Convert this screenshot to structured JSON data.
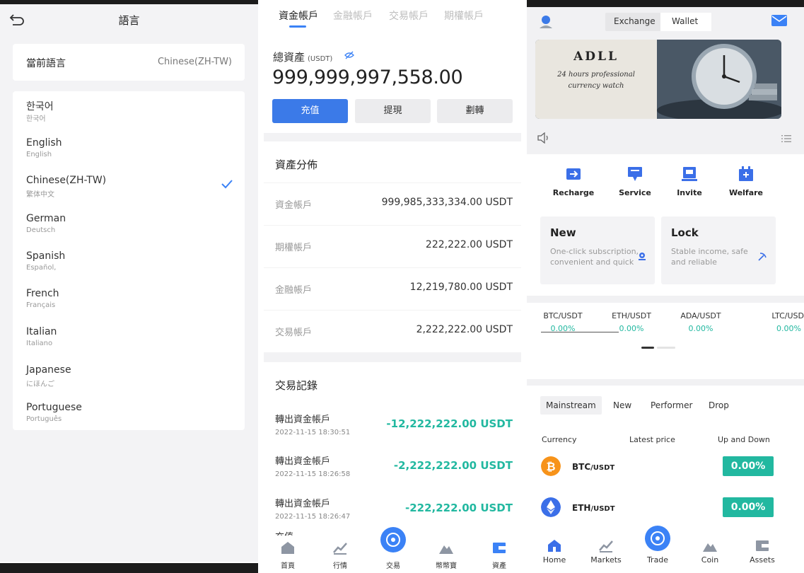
{
  "language_screen": {
    "title": "語言",
    "current_label": "當前語言",
    "current_value": "Chinese(ZH-TW)",
    "languages": [
      {
        "name": "한국어",
        "native": "한국어",
        "selected": false
      },
      {
        "name": "English",
        "native": "English",
        "selected": false
      },
      {
        "name": "Chinese(ZH-TW)",
        "native": "繁体中文",
        "selected": true
      },
      {
        "name": "German",
        "native": "Deutsch",
        "selected": false
      },
      {
        "name": "Spanish",
        "native": "Español,",
        "selected": false
      },
      {
        "name": "French",
        "native": "Français",
        "selected": false
      },
      {
        "name": "Italian",
        "native": "Italiano",
        "selected": false
      },
      {
        "name": "Japanese",
        "native": "にほんご",
        "selected": false
      },
      {
        "name": "Portuguese",
        "native": "Português",
        "selected": false
      }
    ],
    "accent": "#3b82f6"
  },
  "funds_screen": {
    "tabs": [
      "資金帳戶",
      "金融帳戶",
      "交易帳戶",
      "期權帳戶"
    ],
    "active_tab": 0,
    "total_label": "總資產",
    "total_unit": "(USDT)",
    "total_value": "999,999,997,558.00",
    "buttons": {
      "deposit": "充值",
      "withdraw": "提現",
      "transfer": "劃轉"
    },
    "distribution_title": "資產分佈",
    "distribution": [
      {
        "name": "資金帳戶",
        "value": "999,985,333,334.00 USDT"
      },
      {
        "name": "期權帳戶",
        "value": "222,222.00 USDT"
      },
      {
        "name": "金融帳戶",
        "value": "12,219,780.00 USDT"
      },
      {
        "name": "交易帳戶",
        "value": "2,222,222.00 USDT"
      }
    ],
    "records_title": "交易記錄",
    "records": [
      {
        "type": "轉出資金帳戶",
        "time": "2022-11-15 18:30:51",
        "amount": "-12,222,222.00 USDT"
      },
      {
        "type": "轉出資金帳戶",
        "time": "2022-11-15 18:26:58",
        "amount": "-2,222,222.00 USDT"
      },
      {
        "type": "轉出資金帳戶",
        "time": "2022-11-15 18:26:47",
        "amount": "-222,222.00 USDT"
      }
    ],
    "records_partial": "充值",
    "nav": [
      "首頁",
      "行情",
      "交易",
      "幣幣寶",
      "資產"
    ],
    "positive_color": "#22b8a0"
  },
  "exchange_screen": {
    "segment": {
      "exchange": "Exchange",
      "wallet": "Wallet",
      "active": "wallet"
    },
    "banner": {
      "title": "ADLL",
      "subtitle_1": "24 hours professional",
      "subtitle_2": "currency watch"
    },
    "quick_actions": [
      "Recharge",
      "Service",
      "Invite",
      "Welfare"
    ],
    "cards": [
      {
        "title": "New",
        "desc_1": "One-click subscription,",
        "desc_2": "convenient and quick"
      },
      {
        "title": "Lock",
        "desc_1": "Stable income, safe",
        "desc_2": "and reliable"
      }
    ],
    "tickers": [
      {
        "pair": "BTC/USDT",
        "change": "0.00%"
      },
      {
        "pair": "ETH/USDT",
        "change": "0.00%"
      },
      {
        "pair": "ADA/USDT",
        "change": "0.00%"
      },
      {
        "pair": "LTC/USD",
        "change": "0.00%"
      }
    ],
    "market_tabs": [
      "Mainstream",
      "New",
      "Performer",
      "Drop"
    ],
    "market_headers": {
      "currency": "Currency",
      "price": "Latest price",
      "change": "Up and Down"
    },
    "market_rows": [
      {
        "base": "BTC",
        "quote": "/USDT",
        "change": "0.00%",
        "icon": "bitcoin-icon",
        "color": "#f7931a"
      },
      {
        "base": "ETH",
        "quote": "/USDT",
        "change": "0.00%",
        "icon": "ethereum-icon",
        "color": "#3b6fe8"
      }
    ],
    "nav": [
      "Home",
      "Markets",
      "Trade",
      "Coin",
      "Assets"
    ],
    "accent": "#3b82f6",
    "positive_color": "#22b8a0"
  }
}
